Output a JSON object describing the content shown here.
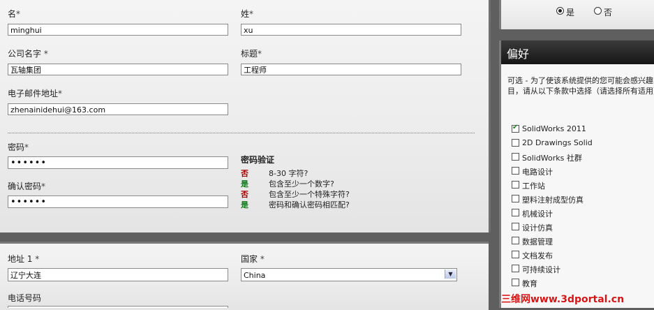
{
  "form": {
    "first_name": {
      "label": "名",
      "req": "*",
      "value": "minghui"
    },
    "last_name": {
      "label": "姓",
      "req": "*",
      "value": "xu"
    },
    "company": {
      "label": "公司名字",
      "req": "*",
      "value": "瓦轴集团"
    },
    "title": {
      "label": "标题",
      "req": "*",
      "value": "工程师"
    },
    "email": {
      "label": "电子邮件地址",
      "req": "*",
      "value": "zhenainidehui@163.com"
    },
    "password": {
      "label": "密码",
      "req": "*",
      "value": "••••••"
    },
    "confirm_password": {
      "label": "确认密码",
      "req": "*",
      "value": "••••••"
    }
  },
  "password_verify": {
    "title": "密码验证",
    "rules": [
      {
        "status": "否",
        "text": "8-30 字符?"
      },
      {
        "status": "是",
        "text": "包含至少一个数字?"
      },
      {
        "status": "否",
        "text": "包含至少一个特殊字符?"
      },
      {
        "status": "是",
        "text": "密码和确认密码相匹配?"
      }
    ]
  },
  "address": {
    "address1": {
      "label": "地址 1",
      "req": "*",
      "value": "辽宁大连"
    },
    "country": {
      "label": "国家",
      "req": "*",
      "value": "China"
    },
    "phone": {
      "label": "电话号码"
    }
  },
  "radio": {
    "yes": "是",
    "no": "否",
    "selected": "yes"
  },
  "preferences": {
    "title": "偏好",
    "description": "可选 - 为了使该系统提供的您可能会感兴趣的项目，请从以下条款中选择（请选择所有适用）。",
    "options": [
      {
        "label": "SolidWorks 2011",
        "checked": true
      },
      {
        "label": "2D Drawings Solid",
        "checked": false
      },
      {
        "label": "SolidWorks 社群",
        "checked": false
      },
      {
        "label": "电路设计",
        "checked": false
      },
      {
        "label": "工作站",
        "checked": false
      },
      {
        "label": "塑料注射成型仿真",
        "checked": false
      },
      {
        "label": "机械设计",
        "checked": false
      },
      {
        "label": "设计仿真",
        "checked": false
      },
      {
        "label": "数据管理",
        "checked": false
      },
      {
        "label": "文档发布",
        "checked": false
      },
      {
        "label": "可持续设计",
        "checked": false
      },
      {
        "label": "教育",
        "checked": false
      }
    ]
  },
  "watermark": "三维网www.3dportal.cn"
}
